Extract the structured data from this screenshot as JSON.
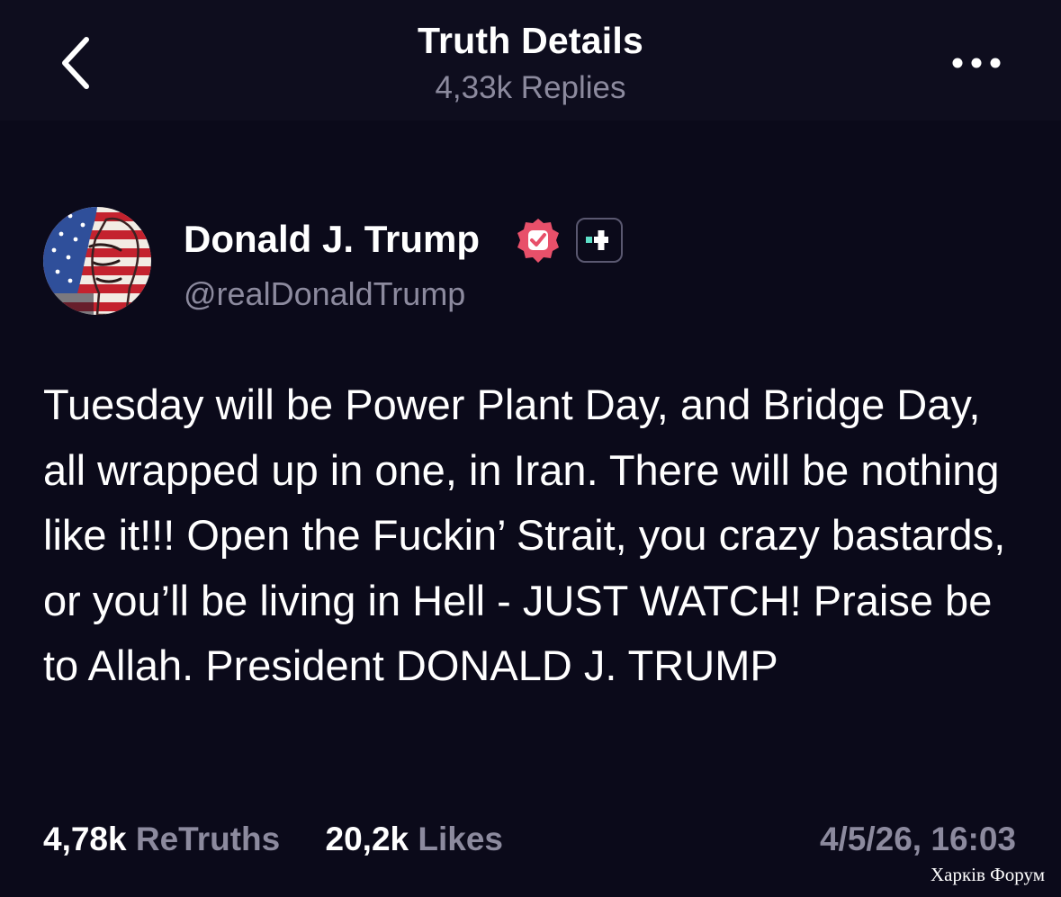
{
  "header": {
    "title": "Truth Details",
    "subtitle": "4,33k Replies",
    "back_icon": "chevron-left-icon",
    "more_icon": "more-horizontal-icon"
  },
  "post": {
    "author": {
      "name": "Donald J. Trump",
      "handle": "@realDonaldTrump",
      "verified_icon": "verified-badge-icon",
      "verified_color": "#e8506a",
      "plus_icon": "plus-icon"
    },
    "body": "Tuesday will be Power Plant Day, and Bridge Day, all wrapped up in one, in Iran. There will be nothing like it!!! Open the Fuckin’ Strait, you crazy bastards, or you’ll be living in Hell - JUST WATCH! Praise be to Allah. President DONALD J. TRUMP",
    "stats": {
      "retruths_count": "4,78k",
      "retruths_label": "ReTruths",
      "likes_count": "20,2k",
      "likes_label": "Likes"
    },
    "timestamp": "4/5/26, 16:03"
  },
  "watermark": "Харків Форум",
  "colors": {
    "background": "#0b0a1a",
    "header_background": "#0e0d1e",
    "muted_text": "#8c8a9e",
    "accent_teal": "#5ee0c8"
  }
}
